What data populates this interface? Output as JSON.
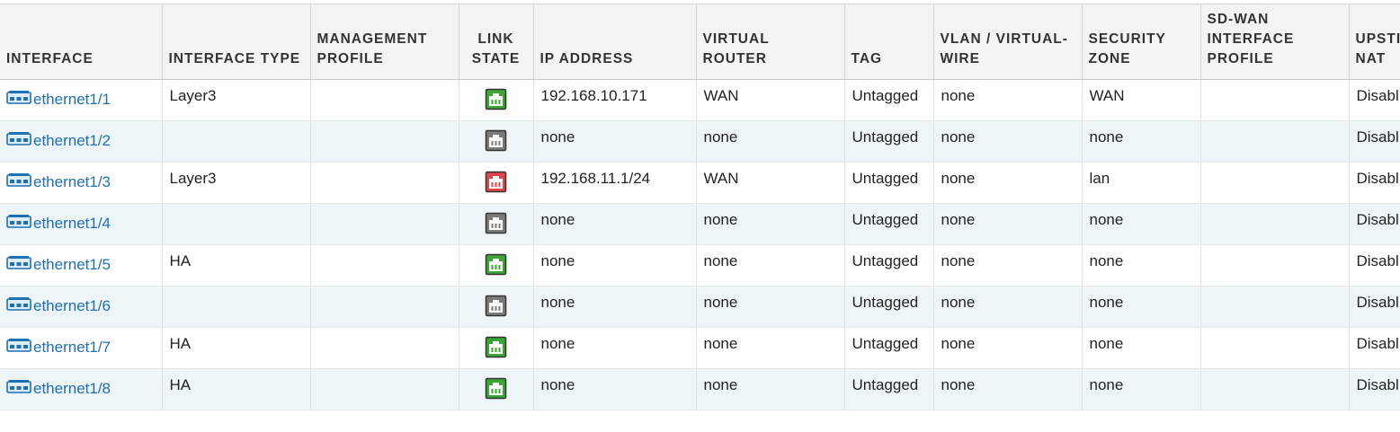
{
  "columns": [
    {
      "key": "interface",
      "lines": [
        "",
        "INTERFACE"
      ]
    },
    {
      "key": "type",
      "lines": [
        "",
        "INTERFACE TYPE"
      ]
    },
    {
      "key": "mgmt",
      "lines": [
        "MANAGEMENT",
        "PROFILE"
      ]
    },
    {
      "key": "link",
      "lines": [
        "LINK",
        "STATE"
      ]
    },
    {
      "key": "ip",
      "lines": [
        "",
        "IP ADDRESS"
      ]
    },
    {
      "key": "vr",
      "lines": [
        "VIRTUAL",
        "ROUTER"
      ]
    },
    {
      "key": "tag",
      "lines": [
        "",
        "TAG"
      ]
    },
    {
      "key": "vlan",
      "lines": [
        "VLAN / VIRTUAL-",
        "WIRE"
      ]
    },
    {
      "key": "zone",
      "lines": [
        "SECURITY",
        "ZONE"
      ]
    },
    {
      "key": "sdwan",
      "lines": [
        "SD-WAN",
        "INTERFACE",
        "PROFILE"
      ]
    },
    {
      "key": "upstream",
      "lines": [
        "UPSTI",
        "NAT"
      ]
    }
  ],
  "rows": [
    {
      "interface": "ethernet1/1",
      "type": "Layer3",
      "mgmt": "",
      "link": "up",
      "ip": "192.168.10.171",
      "vr": "WAN",
      "tag": "Untagged",
      "vlan": "none",
      "zone": "WAN",
      "sdwan": "",
      "upstream": "Disabl"
    },
    {
      "interface": "ethernet1/2",
      "type": "",
      "mgmt": "",
      "link": "unknown",
      "ip": "none",
      "vr": "none",
      "tag": "Untagged",
      "vlan": "none",
      "zone": "none",
      "sdwan": "",
      "upstream": "Disabl"
    },
    {
      "interface": "ethernet1/3",
      "type": "Layer3",
      "mgmt": "",
      "link": "down",
      "ip": "192.168.11.1/24",
      "vr": "WAN",
      "tag": "Untagged",
      "vlan": "none",
      "zone": "lan",
      "sdwan": "",
      "upstream": "Disabl"
    },
    {
      "interface": "ethernet1/4",
      "type": "",
      "mgmt": "",
      "link": "unknown",
      "ip": "none",
      "vr": "none",
      "tag": "Untagged",
      "vlan": "none",
      "zone": "none",
      "sdwan": "",
      "upstream": "Disabl"
    },
    {
      "interface": "ethernet1/5",
      "type": "HA",
      "mgmt": "",
      "link": "up",
      "ip": "none",
      "vr": "none",
      "tag": "Untagged",
      "vlan": "none",
      "zone": "none",
      "sdwan": "",
      "upstream": "Disabl"
    },
    {
      "interface": "ethernet1/6",
      "type": "",
      "mgmt": "",
      "link": "unknown",
      "ip": "none",
      "vr": "none",
      "tag": "Untagged",
      "vlan": "none",
      "zone": "none",
      "sdwan": "",
      "upstream": "Disabl"
    },
    {
      "interface": "ethernet1/7",
      "type": "HA",
      "mgmt": "",
      "link": "up",
      "ip": "none",
      "vr": "none",
      "tag": "Untagged",
      "vlan": "none",
      "zone": "none",
      "sdwan": "",
      "upstream": "Disabl"
    },
    {
      "interface": "ethernet1/8",
      "type": "HA",
      "mgmt": "",
      "link": "up",
      "ip": "none",
      "vr": "none",
      "tag": "Untagged",
      "vlan": "none",
      "zone": "none",
      "sdwan": "",
      "upstream": "Disabl"
    }
  ],
  "icons": {
    "interface": "ethernet-port-icon",
    "link_up": "link-up-icon",
    "link_down": "link-down-icon",
    "link_unknown": "link-unknown-icon"
  },
  "colors": {
    "link_up": "#3aa635",
    "link_down": "#e0454a",
    "link_unknown": "#7a7a7a",
    "link_text": "#1f6fb5",
    "alt_row": "#eef5f8"
  }
}
